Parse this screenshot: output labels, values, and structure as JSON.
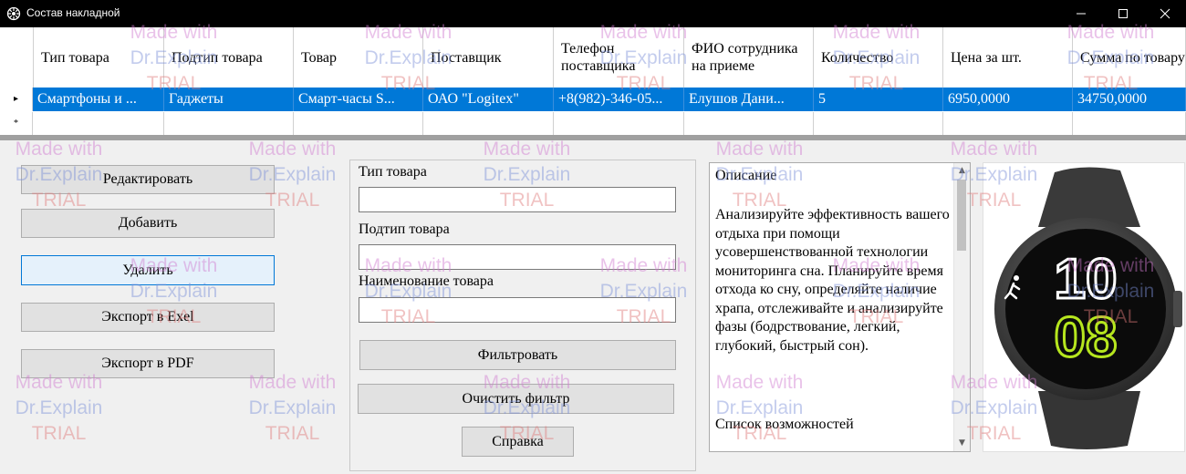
{
  "window": {
    "title": "Состав накладной",
    "minimize_icon": "minimize-icon",
    "maximize_icon": "maximize-icon",
    "close_icon": "close-icon"
  },
  "grid": {
    "columns": [
      "Тип товара",
      "Подтип товара",
      "Товар",
      "Поставщик",
      "Телефон поставщика",
      "ФИО сотрудника на приеме",
      "Количество",
      "Цена за шт.",
      "Сумма по товару"
    ],
    "rows": [
      [
        "Смартфоны и ...",
        "Гаджеты",
        "Смарт-часы S...",
        "ОАО \"Logitex\"",
        "+8(982)-346-05...",
        "Елушов Дани...",
        "5",
        "6950,0000",
        "34750,0000"
      ]
    ],
    "current_row_marker": "▸",
    "new_row_marker": "*"
  },
  "buttons": {
    "edit": "Редактировать",
    "add": "Добавить",
    "delete": "Удалить",
    "export_excel": "Экспорт в Exel",
    "export_pdf": "Экспорт в PDF"
  },
  "filter": {
    "type_label": "Тип товара",
    "type_value": "",
    "subtype_label": "Подтип товара",
    "subtype_value": "",
    "name_label": "Наименование товара",
    "name_value": "",
    "filter_button": "Фильтровать",
    "clear_button": "Очистить фильтр",
    "help_button": "Справка"
  },
  "description": {
    "title": "Описание",
    "body": "Анализируйте эффективность вашего отдыха при помощи усовершенствованной технологии мониторинга сна. Планируйте время отхода ко сну, определяйте наличие храпа, отслеживайте и анализируйте фазы (бодрствование, легкий, глубокий, быстрый сон).",
    "list_title": "Список возможностей"
  },
  "product_image": {
    "hours": "10",
    "minutes": "08",
    "accent_color": "#b6e61e"
  },
  "watermark": {
    "line1": "Made with",
    "line2": "Dr.Explain",
    "line3": "TRIAL"
  }
}
